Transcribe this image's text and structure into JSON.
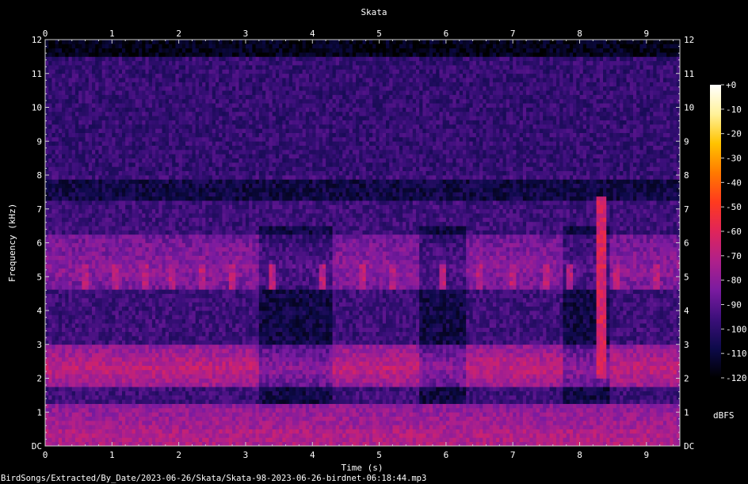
{
  "chart_data": {
    "type": "heatmap",
    "title": "Skata",
    "xlabel": "Time (s)",
    "ylabel": "Frequency (kHz)",
    "xlim": [
      0,
      9.5
    ],
    "ylim": [
      0,
      12
    ],
    "x_ticks": [
      "0",
      "1",
      "2",
      "3",
      "4",
      "5",
      "6",
      "7",
      "8",
      "9"
    ],
    "y_ticks": [
      "DC",
      "1",
      "2",
      "3",
      "4",
      "5",
      "6",
      "7",
      "8",
      "9",
      "10",
      "11",
      "12"
    ],
    "colorbar": {
      "unit": "dBFS",
      "range": [
        -120,
        0
      ],
      "ticks": [
        "+0",
        "-10",
        "-20",
        "-30",
        "-40",
        "-50",
        "-60",
        "-70",
        "-80",
        "-90",
        "-100",
        "-110",
        "-120"
      ],
      "colormap": [
        "#000000",
        "#0d0a4a",
        "#3b0f7a",
        "#7a1ba0",
        "#b0208a",
        "#e0245a",
        "#ff3a1e",
        "#ff7a00",
        "#ffc300",
        "#fff29a",
        "#ffffff"
      ]
    },
    "grid": false,
    "footer": "BirdSongs/Extracted/By_Date/2023-06-26/Skata/Skata-98-2023-06-26-birdnet-06:18:44.mp3"
  }
}
